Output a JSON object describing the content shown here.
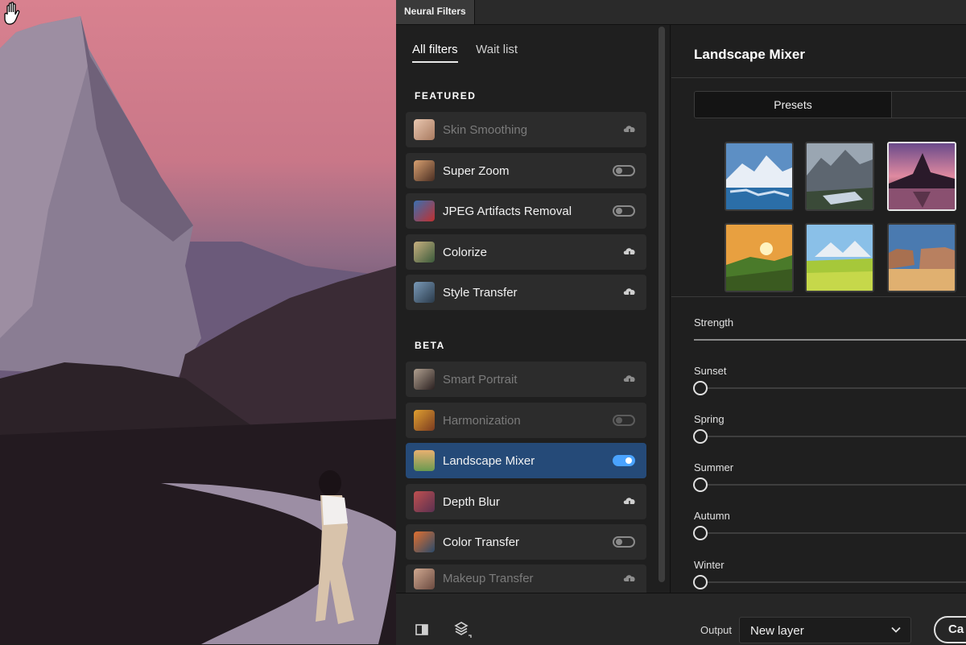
{
  "panel_tab": "Neural Filters",
  "tabs": [
    {
      "label": "All filters",
      "active": true
    },
    {
      "label": "Wait list",
      "active": false
    }
  ],
  "sections": {
    "featured": "FEATURED",
    "beta": "BETA"
  },
  "featured": [
    {
      "name": "Skin Smoothing",
      "state": "download",
      "dim": true
    },
    {
      "name": "Super Zoom",
      "state": "toggle-off",
      "dim": false
    },
    {
      "name": "JPEG Artifacts Removal",
      "state": "toggle-off",
      "dim": false
    },
    {
      "name": "Colorize",
      "state": "download",
      "dim": false
    },
    {
      "name": "Style Transfer",
      "state": "download",
      "dim": false
    }
  ],
  "beta": [
    {
      "name": "Smart Portrait",
      "state": "download",
      "dim": true
    },
    {
      "name": "Harmonization",
      "state": "toggle-off",
      "dim": true
    },
    {
      "name": "Landscape Mixer",
      "state": "toggle-on",
      "dim": false,
      "selected": true
    },
    {
      "name": "Depth Blur",
      "state": "download",
      "dim": false
    },
    {
      "name": "Color Transfer",
      "state": "toggle-off",
      "dim": false
    },
    {
      "name": "Makeup Transfer",
      "state": "download",
      "dim": true
    }
  ],
  "detail": {
    "title": "Landscape Mixer",
    "segment_active": "Presets",
    "selected_preset_index": 2,
    "sliders": [
      {
        "label": "Strength",
        "value": 1.0
      },
      {
        "label": "Sunset",
        "value": 0
      },
      {
        "label": "Spring",
        "value": 0
      },
      {
        "label": "Summer",
        "value": 0
      },
      {
        "label": "Autumn",
        "value": 0
      },
      {
        "label": "Winter",
        "value": 0
      }
    ]
  },
  "bottom": {
    "output_label": "Output",
    "output_value": "New layer",
    "cancel_label": "Ca"
  },
  "colors": {
    "accent": "#4aa3ff",
    "selected_row": "#254a78"
  },
  "icons": {
    "canvas_cursor": "hand-cursor-icon",
    "compare": "split-view-icon",
    "layers": "layers-icon"
  }
}
